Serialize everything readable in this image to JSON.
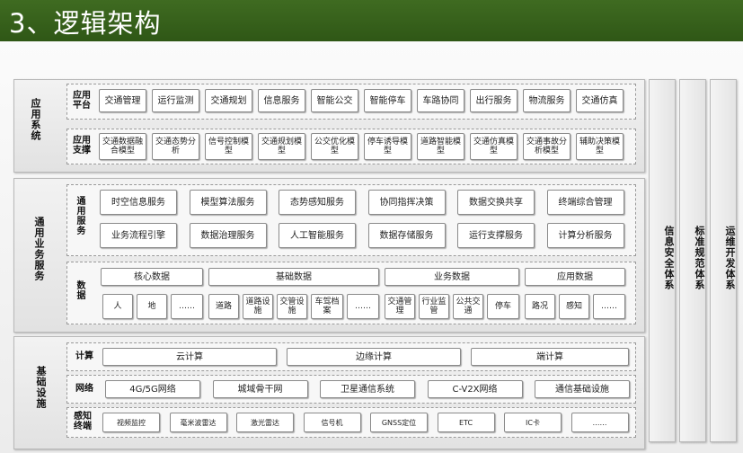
{
  "title": "3、逻辑架构",
  "sections": {
    "app_system": "应用系统",
    "common_service": "通用业务服务",
    "infrastructure": "基础设施"
  },
  "rows": {
    "app_platform": "应用平台",
    "app_support": "应用支撑",
    "common_services": "通用服务",
    "data": "数据",
    "compute": "计算",
    "network": "网络",
    "sensing": "感知终端"
  },
  "app_platform_items": [
    "交通管理",
    "运行监测",
    "交通规划",
    "信息服务",
    "智能公交",
    "智能停车",
    "车路协同",
    "出行服务",
    "物流服务",
    "交通仿真"
  ],
  "app_support_items": [
    "交通数据融合模型",
    "交通态势分析",
    "信号控制模型",
    "交通规划模型",
    "公交优化模型",
    "停车诱导模型",
    "道路智能模型",
    "交通仿真模型",
    "交通事故分析模型",
    "辅助决策模型"
  ],
  "service_items": [
    "时空信息服务",
    "模型算法服务",
    "态势感知服务",
    "协同指挥决策",
    "数据交换共享",
    "终端综合管理",
    "业务流程引擎",
    "数据治理服务",
    "人工智能服务",
    "数据存储服务",
    "运行支撑服务",
    "计算分析服务"
  ],
  "data_categories": [
    "核心数据",
    "基础数据",
    "业务数据",
    "应用数据"
  ],
  "data_items": [
    "人",
    "地",
    "……",
    "道路",
    "道路设施",
    "交管设施",
    "车驾档案",
    "……",
    "交通管理",
    "行业监管",
    "公共交通",
    "停车",
    "路况",
    "感知",
    "……"
  ],
  "compute_items": [
    "云计算",
    "边缘计算",
    "端计算"
  ],
  "network_items": [
    "4G/5G网络",
    "城域骨干网",
    "卫星通信系统",
    "C-V2X网络",
    "通信基础设施"
  ],
  "sensing_items": [
    "视频监控",
    "毫米波雷达",
    "激光雷达",
    "信号机",
    "GNSS定位",
    "ETC",
    "IC卡",
    "……"
  ],
  "side_systems": [
    "信息安全体系",
    "标准规范体系",
    "运维开发体系"
  ]
}
